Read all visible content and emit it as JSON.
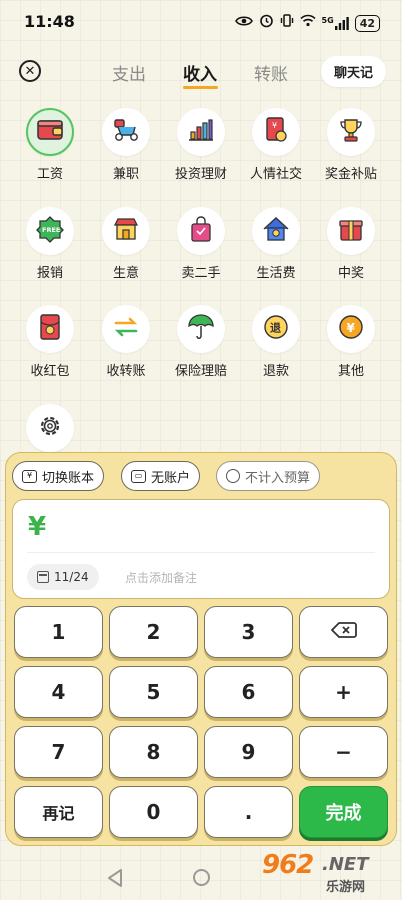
{
  "status_bar": {
    "time": "11:48",
    "signal_label": "5G",
    "battery": "42"
  },
  "header": {
    "close_icon": "close-icon",
    "tabs": [
      {
        "label": "支出",
        "active": false
      },
      {
        "label": "收入",
        "active": true
      },
      {
        "label": "转账",
        "active": false
      }
    ],
    "chat_button": "聊天记"
  },
  "categories": [
    {
      "label": "工资",
      "icon": "wallet-icon",
      "selected": true
    },
    {
      "label": "兼职",
      "icon": "scooter-icon",
      "selected": false
    },
    {
      "label": "投资理财",
      "icon": "bar-chart-icon",
      "selected": false
    },
    {
      "label": "人情社交",
      "icon": "red-envelope-icon",
      "selected": false
    },
    {
      "label": "奖金补贴",
      "icon": "trophy-icon",
      "selected": false
    },
    {
      "label": "报销",
      "icon": "free-badge-icon",
      "selected": false
    },
    {
      "label": "生意",
      "icon": "shop-icon",
      "selected": false
    },
    {
      "label": "卖二手",
      "icon": "shopping-bag-icon",
      "selected": false
    },
    {
      "label": "生活费",
      "icon": "house-icon",
      "selected": false
    },
    {
      "label": "中奖",
      "icon": "gift-box-icon",
      "selected": false
    },
    {
      "label": "收红包",
      "icon": "red-packet-icon",
      "selected": false
    },
    {
      "label": "收转账",
      "icon": "transfer-arrows-icon",
      "selected": false
    },
    {
      "label": "保险理赔",
      "icon": "umbrella-icon",
      "selected": false
    },
    {
      "label": "退款",
      "icon": "refund-coin-icon",
      "selected": false
    },
    {
      "label": "其他",
      "icon": "yuan-coin-icon",
      "selected": false
    },
    {
      "label": "",
      "icon": "settings-gear-icon",
      "selected": false
    }
  ],
  "panel": {
    "switch_book": "切换账本",
    "no_account": "无账户",
    "exclude_budget": "不计入预算",
    "currency_symbol": "¥",
    "date": "11/24",
    "note_placeholder": "点击添加备注"
  },
  "keypad": {
    "rows": [
      [
        "1",
        "2",
        "3",
        "⌫"
      ],
      [
        "4",
        "5",
        "6",
        "+"
      ],
      [
        "7",
        "8",
        "9",
        "−"
      ],
      [
        "再记",
        "0",
        ".",
        "完成"
      ]
    ]
  },
  "watermark": {
    "logo": "962",
    "domain": ".NET",
    "site_name": "乐游网"
  },
  "colors": {
    "accent_orange": "#f5a623",
    "accent_green": "#2db84a",
    "panel_yellow": "#f6e3a2",
    "background": "#f6f3e7"
  }
}
